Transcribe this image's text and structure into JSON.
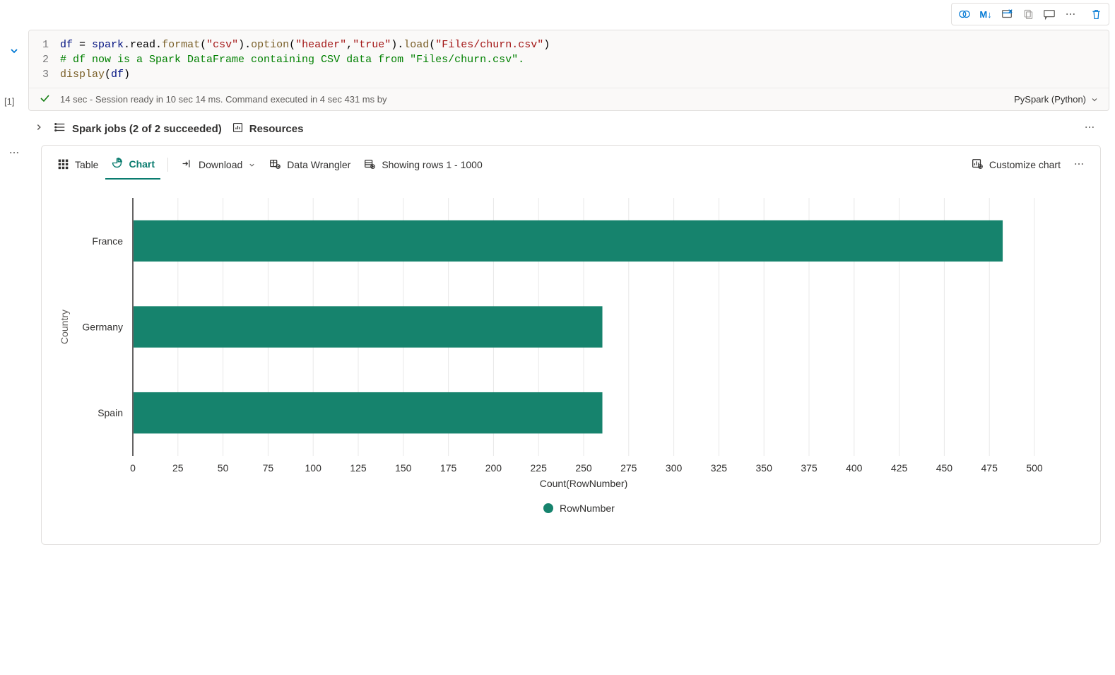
{
  "toolbar": {
    "markdown_label": "M↓"
  },
  "code": {
    "lines": [
      "1",
      "2",
      "3"
    ],
    "line1_tokens": {
      "df": "df",
      "assign": " = ",
      "spark": "spark",
      "dot_read": ".read.",
      "format": "format",
      "p1": "(",
      "str_csv": "\"csv\"",
      "p2": ").",
      "option": "option",
      "p3": "(",
      "str_header": "\"header\"",
      "comma": ",",
      "str_true": "\"true\"",
      "p4": ").",
      "load": "load",
      "p5": "(",
      "str_path": "\"Files/churn.csv\"",
      "p6": ")"
    },
    "line2_comment": "# df now is a Spark DataFrame containing CSV data from \"Files/churn.csv\".",
    "line3_tokens": {
      "display": "display",
      "p1": "(",
      "df": "df",
      "p2": ")"
    }
  },
  "status": {
    "text": "14 sec - Session ready in 10 sec 14 ms. Command executed in 4 sec 431 ms by",
    "kernel": "PySpark (Python)"
  },
  "exec_count": "[1]",
  "meta": {
    "spark_jobs": "Spark jobs (2 of 2 succeeded)",
    "resources": "Resources"
  },
  "output": {
    "tabs": {
      "table": "Table",
      "chart": "Chart"
    },
    "download": "Download",
    "data_wrangler": "Data Wrangler",
    "rows_status": "Showing rows 1 - 1000",
    "customize": "Customize chart"
  },
  "chart_data": {
    "type": "bar",
    "orientation": "horizontal",
    "categories": [
      "France",
      "Germany",
      "Spain"
    ],
    "values": [
      482,
      260,
      260
    ],
    "series_name": "RowNumber",
    "ylabel": "Country",
    "xlabel": "Count(RowNumber)",
    "xlim": [
      0,
      500
    ],
    "xtick_step": 25,
    "xticks": [
      "0",
      "25",
      "50",
      "75",
      "100",
      "125",
      "150",
      "175",
      "200",
      "225",
      "250",
      "275",
      "300",
      "325",
      "350",
      "375",
      "400",
      "425",
      "450",
      "475",
      "500"
    ],
    "legend": "RowNumber",
    "bar_color": "#16836d"
  }
}
